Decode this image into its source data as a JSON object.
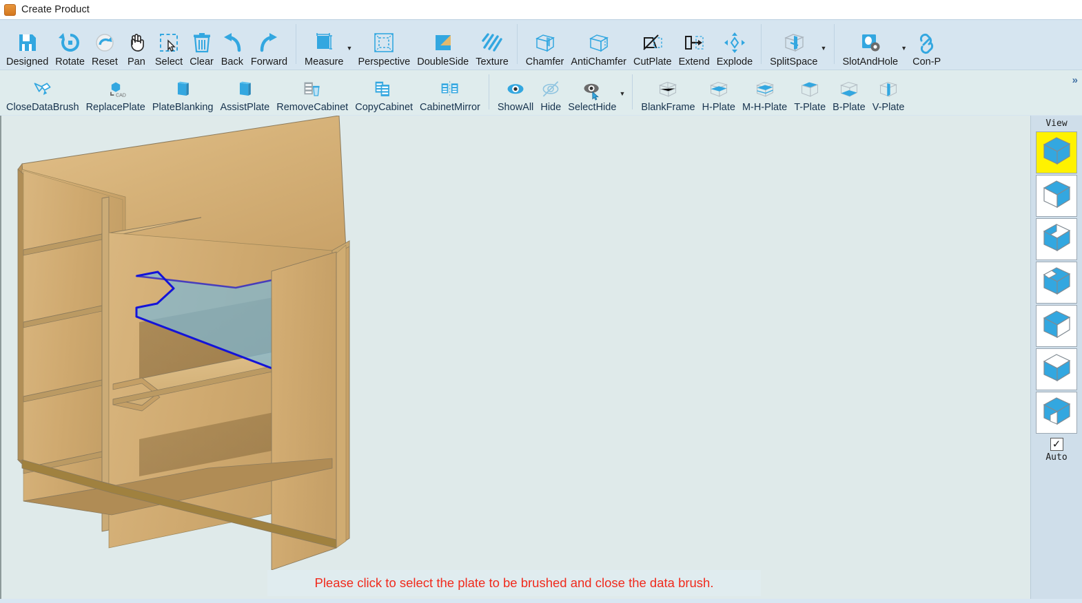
{
  "window": {
    "title": "Create Product",
    "icon": "app-orange-square-icon"
  },
  "colors": {
    "ribbon_bg": "#d6e5f0",
    "ribbon_row2_bg": "#dfeced",
    "canvas_bg": "#dfeaea",
    "accent_blue": "#33a7e0",
    "status_red": "#f02a1c",
    "view_active_yellow": "#fff200",
    "selection_fill": "#7fb8d4",
    "selection_outline": "#1414d8",
    "wood_light": "#dcb87e",
    "wood_mid": "#c9a268",
    "wood_dark": "#8a6b3c"
  },
  "ribbon": {
    "overflow_chevron": "»",
    "row1": [
      {
        "label": "Designed",
        "icon": "save-disk-icon",
        "caret": false
      },
      {
        "label": "Rotate",
        "icon": "rotate-ccw-icon",
        "caret": false
      },
      {
        "label": "Reset",
        "icon": "reset-redo-icon",
        "caret": false
      },
      {
        "label": "Pan",
        "icon": "hand-pan-icon",
        "caret": false
      },
      {
        "label": "Select",
        "icon": "marquee-select-icon",
        "caret": false
      },
      {
        "label": "Clear",
        "icon": "trash-icon",
        "caret": false
      },
      {
        "label": "Back",
        "icon": "arrow-undo-icon",
        "caret": false
      },
      {
        "label": "Forward",
        "icon": "arrow-redo-icon",
        "caret": false
      },
      {
        "label": "Measure",
        "icon": "measure-square-icon",
        "caret": true
      },
      {
        "label": "Perspective",
        "icon": "perspective-frame-icon",
        "caret": false
      },
      {
        "label": "DoubleSide",
        "icon": "doubleside-icon",
        "caret": false
      },
      {
        "label": "Texture",
        "icon": "texture-hatch-icon",
        "caret": false
      },
      {
        "label": "Chamfer",
        "icon": "chamfer-cube-icon",
        "caret": false
      },
      {
        "label": "AntiChamfer",
        "icon": "antichamfer-cube-icon",
        "caret": false
      },
      {
        "label": "CutPlate",
        "icon": "cutplate-icon",
        "caret": false
      },
      {
        "label": "Extend",
        "icon": "extend-arrow-icon",
        "caret": false
      },
      {
        "label": "Explode",
        "icon": "explode-arrows-icon",
        "caret": false
      },
      {
        "label": "SplitSpace",
        "icon": "splitspace-cube-icon",
        "caret": true
      },
      {
        "label": "SlotAndHole",
        "icon": "slot-and-hole-icon",
        "caret": true
      },
      {
        "label": "Con-P",
        "icon": "chain-link-icon",
        "caret": false
      }
    ],
    "row1_separators_after": [
      "Forward",
      "Texture",
      "Explode",
      "SplitSpace"
    ],
    "row2": [
      {
        "label": "CloseDataBrush",
        "icon": "paint-brush-icon",
        "caret": false
      },
      {
        "label": "ReplacePlate",
        "icon": "replace-plate-cad-icon",
        "caret": false
      },
      {
        "label": "PlateBlanking",
        "icon": "blue-plate-icon",
        "caret": false
      },
      {
        "label": "AssistPlate",
        "icon": "blue-plate-icon",
        "caret": false
      },
      {
        "label": "RemoveCabinet",
        "icon": "remove-cabinet-icon",
        "caret": false
      },
      {
        "label": "CopyCabinet",
        "icon": "copy-cabinet-icon",
        "caret": false
      },
      {
        "label": "CabinetMirror",
        "icon": "cabinet-mirror-icon",
        "caret": false
      },
      {
        "label": "ShowAll",
        "icon": "eye-open-icon",
        "caret": false
      },
      {
        "label": "Hide",
        "icon": "eye-crossed-icon",
        "caret": false
      },
      {
        "label": "SelectHide",
        "icon": "eye-cursor-icon",
        "caret": true
      },
      {
        "label": "BlankFrame",
        "icon": "blank-frame-cube-icon",
        "caret": false
      },
      {
        "label": "H-Plate",
        "icon": "h-plate-cube-icon",
        "caret": false
      },
      {
        "label": "M-H-Plate",
        "icon": "mh-plate-cube-icon",
        "caret": false
      },
      {
        "label": "T-Plate",
        "icon": "t-plate-cube-icon",
        "caret": false
      },
      {
        "label": "B-Plate",
        "icon": "b-plate-cube-icon",
        "caret": false
      },
      {
        "label": "V-Plate",
        "icon": "v-plate-cube-icon",
        "caret": false
      }
    ],
    "row2_separators_after": [
      "CabinetMirror",
      "SelectHide"
    ]
  },
  "view_panel": {
    "title": "View",
    "presets": [
      {
        "name": "view-preset-1",
        "icon": "cube-iso-all-faces-icon",
        "active": true
      },
      {
        "name": "view-preset-2",
        "icon": "cube-front-open-icon",
        "active": false
      },
      {
        "name": "view-preset-3",
        "icon": "cube-quarter-cut-icon",
        "active": false
      },
      {
        "name": "view-preset-4",
        "icon": "cube-corner-cut-icon",
        "active": false
      },
      {
        "name": "view-preset-5",
        "icon": "cube-right-open-icon",
        "active": false
      },
      {
        "name": "view-preset-6",
        "icon": "cube-top-open-icon",
        "active": false
      },
      {
        "name": "view-preset-7",
        "icon": "cube-interior-split-icon",
        "active": false
      }
    ],
    "auto": {
      "label": "Auto",
      "checked": true,
      "glyph": "✓"
    }
  },
  "status": {
    "message": "Please click to select the plate to be brushed and close the data brush."
  },
  "model": {
    "description": "Isometric 3D wardrobe cabinet with a left compartment containing four shelves and a right compartment containing notched shelves; one notched shelf is selected and highlighted in blue.",
    "selected_plate": "notched-shelf-plate",
    "left_compartment_shelves": 4,
    "right_compartment_shelves": 2
  }
}
